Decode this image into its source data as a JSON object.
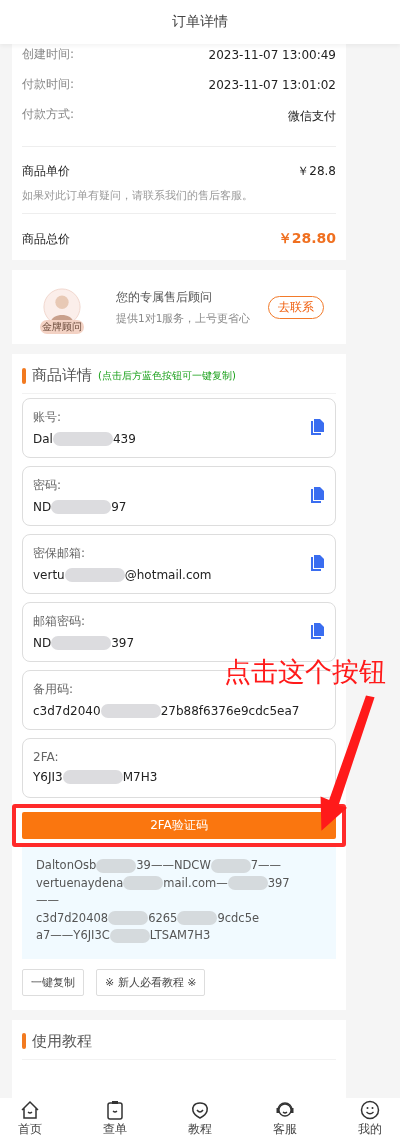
{
  "header": {
    "title": "订单详情"
  },
  "order_info": {
    "rows": [
      {
        "label": "创建时间:",
        "value": "2023-11-07 13:00:49"
      },
      {
        "label": "付款时间:",
        "value": "2023-11-07 13:01:02"
      },
      {
        "label": "付款方式:",
        "value": "微信支付"
      }
    ],
    "unit_price": {
      "label": "商品单价",
      "value": "￥28.8"
    },
    "note": "如果对此订单有疑问，请联系我们的售后客服。",
    "total": {
      "label": "商品总价",
      "value": "￥28.80"
    }
  },
  "advisor": {
    "badge": "金牌顾问",
    "title": "您的专属售后顾问",
    "subtitle": "提供1对1服务，上号更省心",
    "button": "去联系"
  },
  "product": {
    "title": "商品详情",
    "hint": "(点击后方蓝色按钮可一键复制)",
    "fields": [
      {
        "label": "账号:",
        "value_parts": [
          "Dal",
          "439"
        ],
        "copyable": true
      },
      {
        "label": "密码:",
        "value_parts": [
          "ND",
          "97"
        ],
        "copyable": true
      },
      {
        "label": "密保邮箱:",
        "value_parts": [
          "vertu",
          "@hotmail.com"
        ],
        "copyable": true
      },
      {
        "label": "邮箱密码:",
        "value_parts": [
          "ND",
          "397"
        ],
        "copyable": true
      },
      {
        "label": "备用码:",
        "value_parts": [
          "c3d7d2040",
          "27b88f6376e9cdc5ea7"
        ],
        "copyable": false
      },
      {
        "label": "2FA:",
        "value_parts": [
          "Y6JI3",
          "M7H3"
        ],
        "copyable": false
      }
    ],
    "verify_button": "2FA验证码",
    "combined_lines": [
      [
        "DaltonOsb",
        "39——NDCW",
        "7——"
      ],
      [
        "vertuenaydena",
        "mail.com—",
        "397"
      ],
      [
        "——"
      ],
      [
        "c3d7d20408",
        "6265",
        "9cdc5e"
      ],
      [
        "a7——Y6JI3C",
        "LTSAM7H3"
      ]
    ],
    "buttons": [
      "一键复制",
      "※ 新人必看教程 ※"
    ]
  },
  "tutorial": {
    "title": "使用教程"
  },
  "annotation": {
    "text": "点击这个按钮"
  },
  "tab_bar": [
    {
      "label": "首页"
    },
    {
      "label": "查单"
    },
    {
      "label": "教程"
    },
    {
      "label": "客服"
    },
    {
      "label": "我的"
    }
  ]
}
